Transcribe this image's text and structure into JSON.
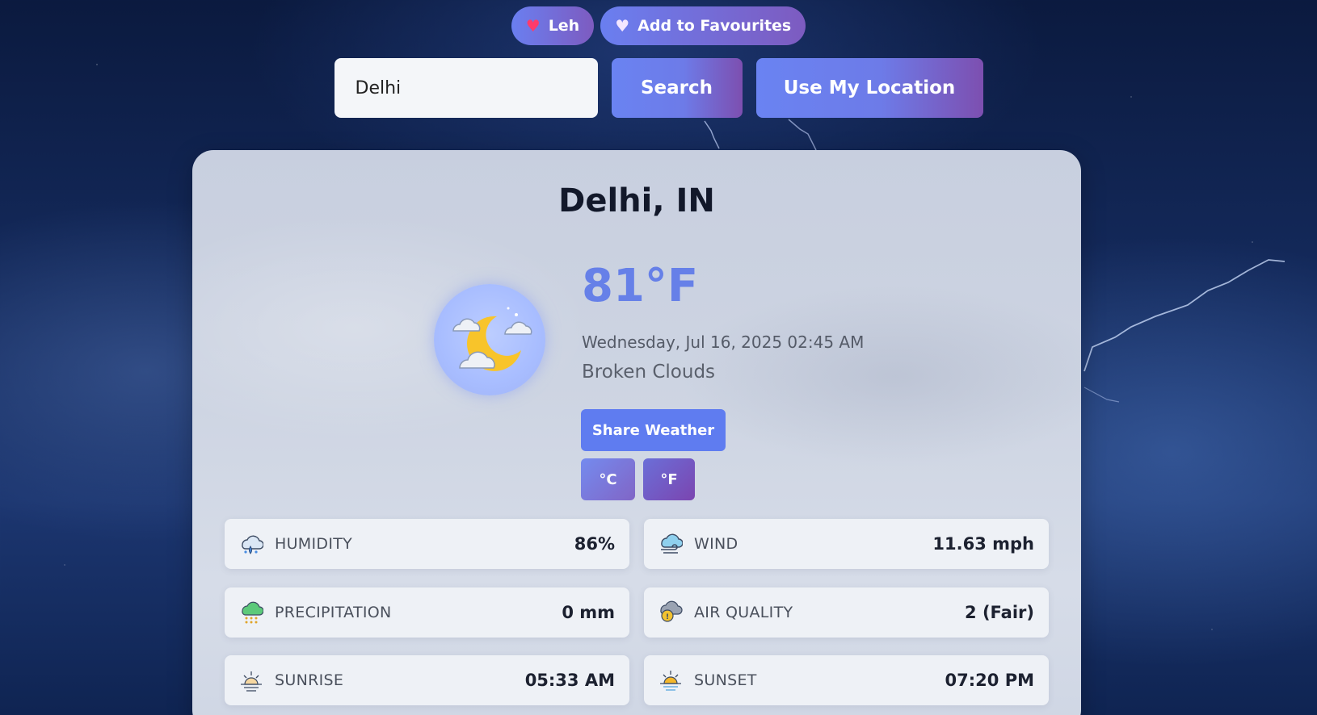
{
  "favourites": {
    "saved_city": "Leh",
    "add_label": "Add to Favourites"
  },
  "search": {
    "value": "Delhi",
    "placeholder": "",
    "search_label": "Search",
    "location_label": "Use My Location"
  },
  "weather": {
    "city": "Delhi, IN",
    "temperature": "81°F",
    "datetime": "Wednesday, Jul 16, 2025 02:45 AM",
    "description": "Broken Clouds",
    "icon": "moon-clouds-icon",
    "share_label": "Share Weather",
    "unit_c_label": "°C",
    "unit_f_label": "°F",
    "active_unit": "F"
  },
  "stats": [
    {
      "label": "HUMIDITY",
      "value": "86%",
      "icon": "humidity-icon"
    },
    {
      "label": "WIND",
      "value": "11.63 mph",
      "icon": "wind-icon"
    },
    {
      "label": "PRECIPITATION",
      "value": "0 mm",
      "icon": "precipitation-icon"
    },
    {
      "label": "AIR QUALITY",
      "value": "2 (Fair)",
      "icon": "air-quality-icon"
    },
    {
      "label": "SUNRISE",
      "value": "05:33 AM",
      "icon": "sunrise-icon"
    },
    {
      "label": "SUNSET",
      "value": "07:20 PM",
      "icon": "sunset-icon"
    }
  ],
  "colors": {
    "accent": "#6680e8",
    "button_gradient_start": "#6a83f2",
    "button_gradient_end": "#7d4fb0",
    "favourite_heart": "#ff3b6b"
  }
}
